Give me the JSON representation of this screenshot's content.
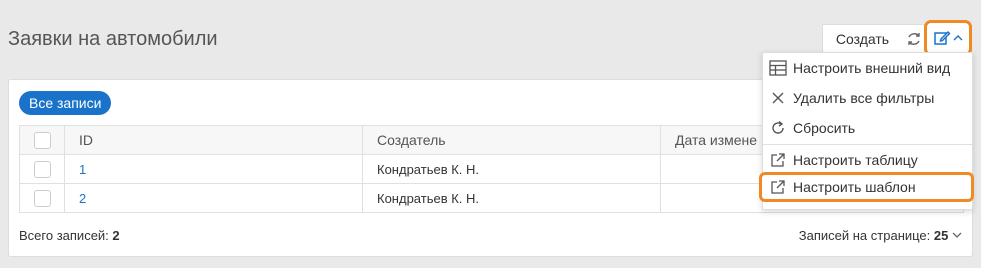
{
  "page": {
    "title": "Заявки на автомобили"
  },
  "toolbar": {
    "create_label": "Создать"
  },
  "filters": {
    "all_records_label": "Все записи"
  },
  "table": {
    "columns": [
      "ID",
      "Создатель",
      "Дата измене"
    ],
    "rows": [
      {
        "id": "1",
        "creator": "Кондратьев К. Н."
      },
      {
        "id": "2",
        "creator": "Кондратьев К. Н."
      }
    ]
  },
  "footer": {
    "total_label": "Всего записей:",
    "total_value": "2",
    "per_page_label": "Записей на странице:",
    "per_page_value": "25"
  },
  "menu": {
    "items": [
      {
        "label": "Настроить внешний вид",
        "icon": "table-layout-icon"
      },
      {
        "label": "Удалить все фильтры",
        "icon": "close-icon"
      },
      {
        "label": "Сбросить",
        "icon": "reset-icon"
      },
      {
        "label": "Настроить таблицу",
        "icon": "external-link-icon"
      },
      {
        "label": "Настроить шаблон",
        "icon": "external-link-icon"
      }
    ]
  },
  "colors": {
    "accent": "#1a73c8",
    "highlight": "#f08a24"
  }
}
